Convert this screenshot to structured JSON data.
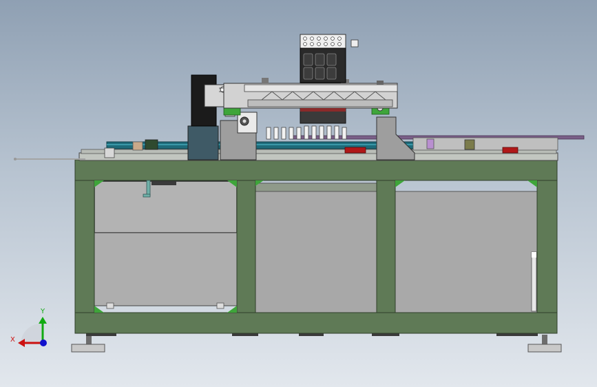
{
  "viewport": {
    "background_top": "#8fa0b3",
    "background_bottom": "#e2e7ed"
  },
  "triad": {
    "x_label": "X",
    "y_label": "Y",
    "x_color": "#cc1111",
    "y_color": "#11aa11",
    "z_color": "#1111cc"
  },
  "model_colors": {
    "frame": "#5f7a56",
    "panel": "#a9a9a9",
    "steel": "#c4c4c4",
    "dark": "#2b2b2b",
    "accent_red": "#b01818",
    "rail": "#1e6b7a"
  }
}
